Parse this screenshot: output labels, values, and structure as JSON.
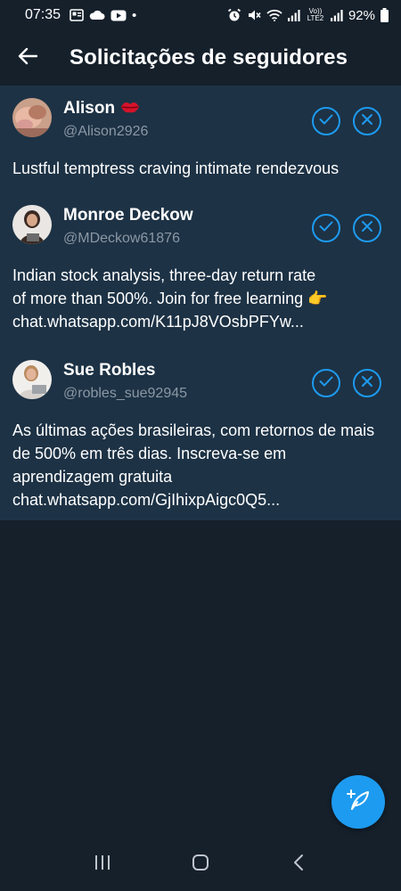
{
  "status_bar": {
    "time": "07:35",
    "battery": "92%",
    "dot": "•",
    "volte": "Vo)) LTE2",
    "icons": [
      "gallery-icon",
      "cloud-icon",
      "youtube-icon",
      "alarm-icon",
      "mute-icon",
      "wifi-icon",
      "signal-icon",
      "battery-icon"
    ]
  },
  "header": {
    "title": "Solicitações de seguidores",
    "back_icon": "arrow-left-icon"
  },
  "requests": [
    {
      "name": "Alison",
      "badge_icon": "lips-icon",
      "handle": "@Alison2926",
      "bio": "Lustful temptress craving intimate rendezvous"
    },
    {
      "name": "Monroe Deckow",
      "handle": "@MDeckow61876",
      "bio_line1": "Indian stock  analysis, three-day  return rate",
      "bio_line2": "of more than 500%. Join for  free learning",
      "bio_emoji": "👉",
      "bio_line3": "chat.whatsapp.com/K11pJ8VOsbPFYw..."
    },
    {
      "name": "Sue Robles",
      "handle": "@robles_sue92945",
      "bio": "As últimas ações brasileiras, com retornos de mais de 500% em três dias. Inscreva-se em aprendizagem gratuita chat.whatsapp.com/GjIhixpAigc0Q5..."
    }
  ],
  "colors": {
    "background": "#15202b",
    "card": "#1d3245",
    "accent": "#1d9bf0",
    "muted": "#8b98a5"
  },
  "fab": {
    "icon": "compose-feather-icon"
  },
  "nav": {
    "icons": [
      "recent-apps-icon",
      "home-icon",
      "back-icon"
    ]
  }
}
